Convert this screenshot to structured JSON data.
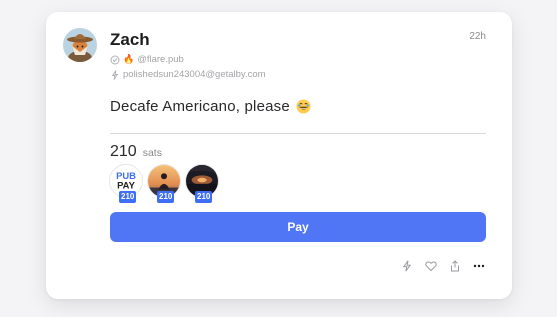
{
  "post": {
    "author_name": "Zach",
    "time": "22h",
    "nip05": "@flare.pub",
    "lightning_address": "polishedsun243004@getalby.com",
    "content": "Decafe Americano, please",
    "content_emoji": "grinning-face-emoji"
  },
  "zaps": {
    "amount": "210",
    "unit": "sats",
    "zappers": [
      {
        "name": "pubpay-logo",
        "logo_top": "PUB",
        "logo_bottom": "PAY",
        "amount": "210"
      },
      {
        "name": "sunset-person-avatar",
        "amount": "210"
      },
      {
        "name": "dark-sunset-avatar",
        "amount": "210"
      }
    ]
  },
  "pay_button": {
    "label": "Pay"
  },
  "actions": {
    "icons": [
      "lightning-icon",
      "heart-icon",
      "share-icon",
      "more-icon"
    ]
  },
  "colors": {
    "accent": "#5176f5",
    "badge": "#3d6ef5",
    "background": "#f4f4f6"
  }
}
